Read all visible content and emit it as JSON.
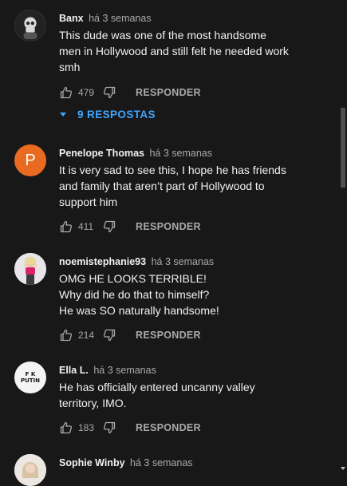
{
  "comments": [
    {
      "author": "Banx",
      "time": "há 3 semanas",
      "lines": [
        "This dude was one of the most handsome",
        "men in Hollywood and still felt he needed work",
        "smh"
      ],
      "likes": "479",
      "reply_label": "RESPONDER",
      "replies_label": "9 RESPOSTAS",
      "avatar_icon": "skull-portrait"
    },
    {
      "author": "Penelope Thomas",
      "time": "há 3 semanas",
      "lines": [
        "It is very sad to see this, I hope he has friends",
        "and family that aren’t part of Hollywood to",
        "support him"
      ],
      "likes": "411",
      "reply_label": "RESPONDER",
      "avatar_letter": "P",
      "avatar_color": "#e96a21"
    },
    {
      "author": "noemistephanie93",
      "time": "há 3 semanas",
      "lines": [
        "OMG HE LOOKS TERRIBLE!",
        "Why did he do that to himself?",
        "He was SO naturally handsome!"
      ],
      "likes": "214",
      "reply_label": "RESPONDER",
      "avatar_icon": "person-photo"
    },
    {
      "author": "Ella L.",
      "time": "há 3 semanas",
      "lines": [
        "He has officially entered uncanny valley",
        "territory, IMO."
      ],
      "likes": "183",
      "reply_label": "RESPONDER",
      "avatar_text_top": "F K",
      "avatar_text_bottom": "PUTIN"
    },
    {
      "author": "Sophie Winby",
      "time": "há 3 semanas",
      "avatar_icon": "person-photo"
    }
  ],
  "colors": {
    "background": "#181818",
    "link": "#3ea6ff",
    "secondary": "#aaaaaa"
  }
}
